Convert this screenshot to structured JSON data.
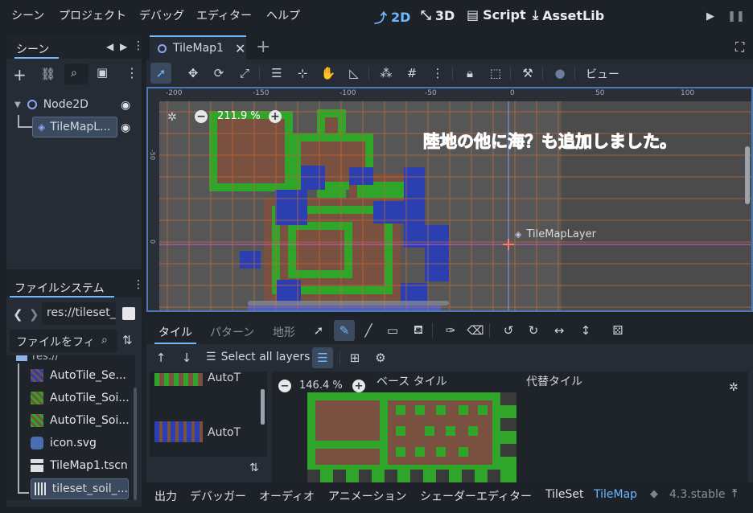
{
  "menubar": {
    "items": [
      "シーン",
      "プロジェクト",
      "デバッグ",
      "エディター",
      "ヘルプ"
    ],
    "modes": [
      {
        "label": "2D",
        "icon": "2d-icon"
      },
      {
        "label": "3D",
        "icon": "3d-icon"
      },
      {
        "label": "Script",
        "icon": "script-icon"
      },
      {
        "label": "AssetLib",
        "icon": "assetlib-icon"
      }
    ],
    "play_icon": "play-icon",
    "pause_icon": "pause-icon"
  },
  "scene_dock": {
    "tab": "シーン",
    "nodes": [
      {
        "label": "Node2D",
        "icon": "node2d-icon"
      },
      {
        "label": "TileMapL...",
        "icon": "tilemaplayer-icon"
      }
    ]
  },
  "filesystem_dock": {
    "tab": "ファイルシステム",
    "path": "res://tileset_",
    "filter_placeholder": "ファイルをフィ",
    "root": "res://",
    "files": [
      {
        "label": "AutoTile_Se...",
        "icon": "tileset-thumb-icon"
      },
      {
        "label": "AutoTile_Soi...",
        "icon": "tileset-thumb-icon"
      },
      {
        "label": "AutoTile_Soi...",
        "icon": "tileset-thumb-icon"
      },
      {
        "label": "icon.svg",
        "icon": "godot-icon"
      },
      {
        "label": "TileMap1.tscn",
        "icon": "scene-clapper-icon"
      },
      {
        "label": "tileset_soil_...",
        "icon": "tileset-file-icon"
      }
    ]
  },
  "editor": {
    "scene_tab": "TileMap1",
    "view_menu": "ビュー",
    "zoom": "211.9 %",
    "ruler_h": [
      "-200",
      "-150",
      "-100",
      "-50",
      "0",
      "50",
      "100"
    ],
    "ruler_v": [
      "-50",
      "0"
    ],
    "annotation": "陸地の他に海？も追加しました。",
    "node_label": "TileMapLayer",
    "annotation_color": "#ff4fc8"
  },
  "tilemap_panel": {
    "tabs": [
      "タイル",
      "パターン",
      "地形"
    ],
    "select_all_layers": "Select all layers",
    "sources": [
      "AutoT",
      "AutoT"
    ],
    "atlas_zoom": "146.4 %",
    "base_tile": "ベース タイル",
    "alt_tile": "代替タイル"
  },
  "bottom_bar": {
    "tabs": [
      "出力",
      "デバッガー",
      "オーディオ",
      "アニメーション",
      "シェーダーエディター",
      "TileSet",
      "TileMap"
    ],
    "version": "4.3.stable",
    "accent": "#6fb7ff"
  }
}
